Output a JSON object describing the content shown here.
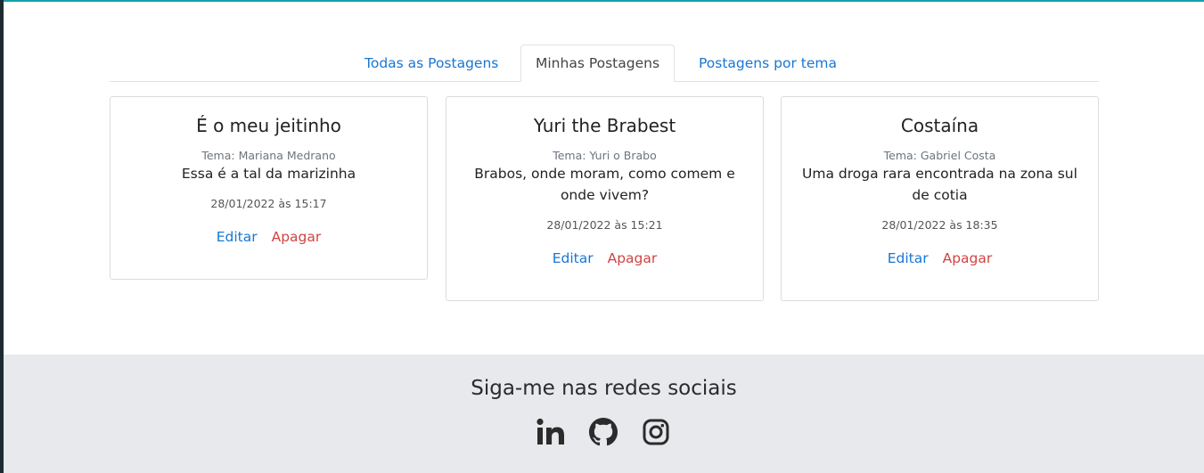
{
  "tabs": [
    {
      "label": "Todas as Postagens",
      "active": false
    },
    {
      "label": "Minhas Postagens",
      "active": true
    },
    {
      "label": "Postagens por tema",
      "active": false
    }
  ],
  "posts": [
    {
      "title": "É o meu jeitinho",
      "theme": "Tema: Mariana Medrano",
      "text": "Essa é a tal da marizinha",
      "date": "28/01/2022 às 15:17",
      "edit_label": "Editar",
      "delete_label": "Apagar"
    },
    {
      "title": "Yuri the Brabest",
      "theme": "Tema: Yuri o Brabo",
      "text": "Brabos, onde moram, como comem e onde vivem?",
      "date": "28/01/2022 às 15:21",
      "edit_label": "Editar",
      "delete_label": "Apagar"
    },
    {
      "title": "Costaína",
      "theme": "Tema: Gabriel Costa",
      "text": "Uma droga rara encontrada na zona sul de cotia",
      "date": "28/01/2022 às 18:35",
      "edit_label": "Editar",
      "delete_label": "Apagar"
    }
  ],
  "footer": {
    "title": "Siga-me nas redes sociais",
    "social_icons": [
      "linkedin-icon",
      "github-icon",
      "instagram-icon"
    ]
  },
  "colors": {
    "link": "#1976d2",
    "danger": "#d14343",
    "footer_bg": "#e8e9ed",
    "accent_top": "#14a0a8"
  }
}
